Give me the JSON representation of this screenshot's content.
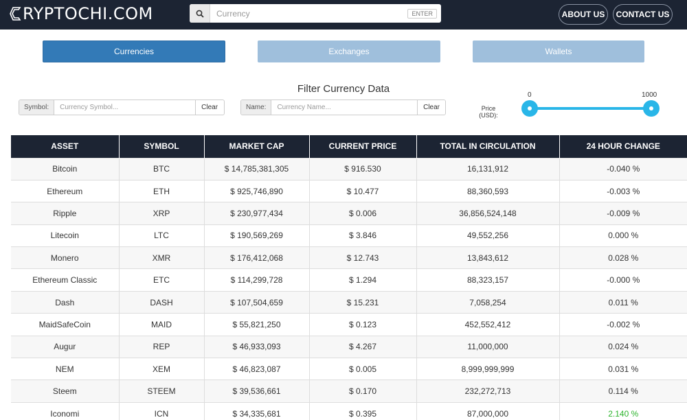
{
  "header": {
    "brand": "RYPTOCHI.COM",
    "search_placeholder": "Currency",
    "enter_label": "ENTER",
    "about_label": "ABOUT US",
    "contact_label": "CONTACT US"
  },
  "tabs": [
    {
      "label": "Currencies",
      "active": true
    },
    {
      "label": "Exchanges",
      "active": false
    },
    {
      "label": "Wallets",
      "active": false
    }
  ],
  "filter": {
    "title": "Filter Currency Data",
    "symbol_label": "Symbol:",
    "symbol_placeholder": "Currency Symbol...",
    "name_label": "Name:",
    "name_placeholder": "Currency Name...",
    "clear_label": "Clear",
    "price_label_line1": "Price",
    "price_label_line2": "(USD):",
    "slider_min": "0",
    "slider_max": "1000"
  },
  "colors": {
    "navbar": "#1c2433",
    "accent": "#337ab7",
    "slider": "#29b6e8",
    "positive": "#2db42d"
  },
  "table": {
    "headers": [
      "ASSET",
      "SYMBOL",
      "MARKET CAP",
      "CURRENT PRICE",
      "TOTAL IN CIRCULATION",
      "24 HOUR CHANGE"
    ],
    "rows": [
      [
        "Bitcoin",
        "BTC",
        "$ 14,785,381,305",
        "$ 916.530",
        "16,131,912",
        "-0.040 %"
      ],
      [
        "Ethereum",
        "ETH",
        "$ 925,746,890",
        "$ 10.477",
        "88,360,593",
        "-0.003 %"
      ],
      [
        "Ripple",
        "XRP",
        "$ 230,977,434",
        "$ 0.006",
        "36,856,524,148",
        "-0.009 %"
      ],
      [
        "Litecoin",
        "LTC",
        "$ 190,569,269",
        "$ 3.846",
        "49,552,256",
        "0.000 %"
      ],
      [
        "Monero",
        "XMR",
        "$ 176,412,068",
        "$ 12.743",
        "13,843,612",
        "0.028 %"
      ],
      [
        "Ethereum Classic",
        "ETC",
        "$ 114,299,728",
        "$ 1.294",
        "88,323,157",
        "-0.000 %"
      ],
      [
        "Dash",
        "DASH",
        "$ 107,504,659",
        "$ 15.231",
        "7,058,254",
        "0.011 %"
      ],
      [
        "MaidSafeCoin",
        "MAID",
        "$ 55,821,250",
        "$ 0.123",
        "452,552,412",
        "-0.002 %"
      ],
      [
        "Augur",
        "REP",
        "$ 46,933,093",
        "$ 4.267",
        "11,000,000",
        "0.024 %"
      ],
      [
        "NEM",
        "XEM",
        "$ 46,823,087",
        "$ 0.005",
        "8,999,999,999",
        "0.031 %"
      ],
      [
        "Steem",
        "STEEM",
        "$ 39,536,661",
        "$ 0.170",
        "232,272,713",
        "0.114 %"
      ],
      [
        "Iconomi",
        "ICN",
        "$ 34,335,681",
        "$ 0.395",
        "87,000,000",
        "2.140 %"
      ]
    ]
  }
}
